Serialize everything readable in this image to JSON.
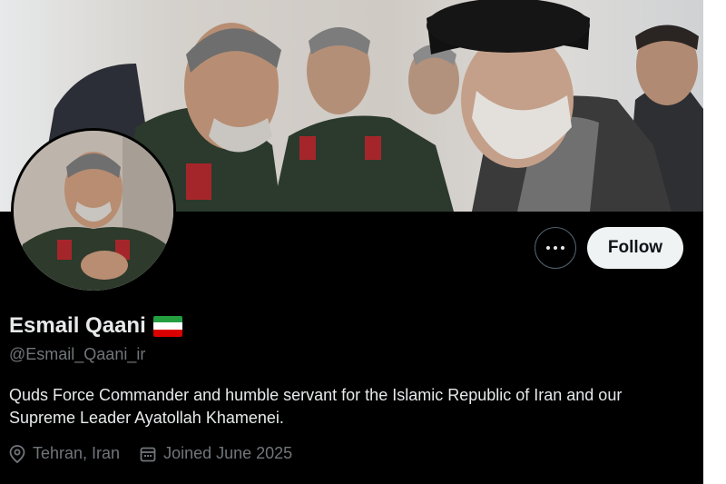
{
  "profile": {
    "display_name": "Esmail Qaani",
    "handle": "@Esmail_Qaani_ir",
    "bio": "Quds Force Commander and humble servant for the Islamic Republic of Iran and our Supreme Leader Ayatollah Khamenei.",
    "location": "Tehran, Iran",
    "joined": "Joined June 2025",
    "flag_icon": "iran-flag-icon"
  },
  "actions": {
    "follow_label": "Follow",
    "more_icon": "more-dots-icon"
  },
  "colors": {
    "background": "#000000",
    "primary_text": "#e7e9ea",
    "secondary_text": "#71767b",
    "follow_button_bg": "#eff3f4",
    "flag_green": "#239f40",
    "flag_white": "#ffffff",
    "flag_red": "#da0000"
  }
}
